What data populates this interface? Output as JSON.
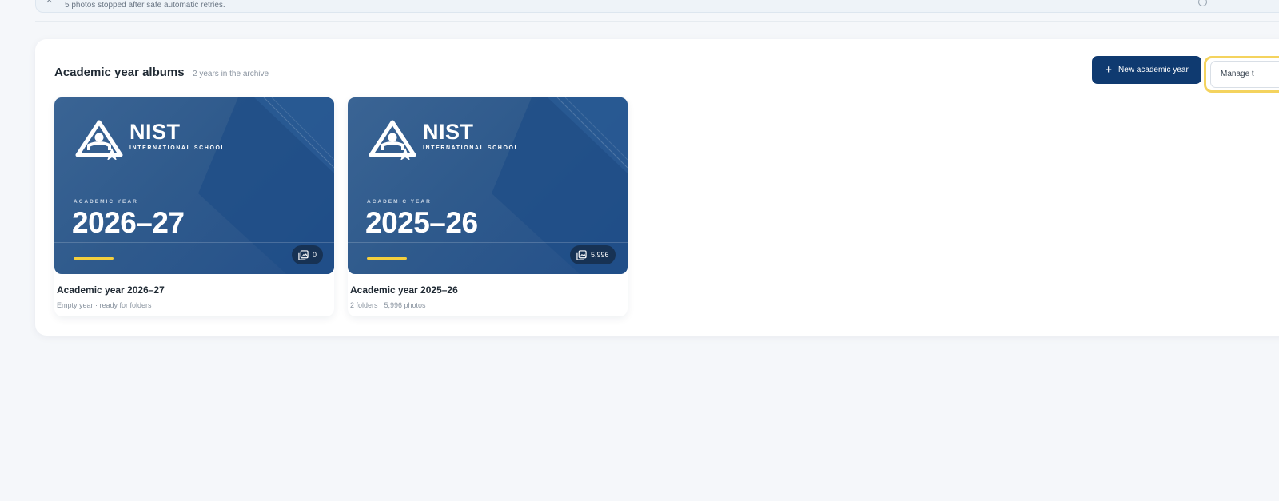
{
  "notice": {
    "text": "5 photos stopped after safe automatic retries."
  },
  "albums_section": {
    "title": "Academic year albums",
    "subtitle": "2 years in the archive",
    "new_year_button": "New academic year",
    "manage_button": "Manage t"
  },
  "albums": [
    {
      "brand_name": "NIST",
      "brand_sub": "INTERNATIONAL SCHOOL",
      "cover_label": "ACADEMIC YEAR",
      "cover_year": "2026–27",
      "photo_count": "0",
      "title": "Academic year 2026–27",
      "meta": "Empty year · ready for folders"
    },
    {
      "brand_name": "NIST",
      "brand_sub": "INTERNATIONAL SCHOOL",
      "cover_label": "ACADEMIC YEAR",
      "cover_year": "2025–26",
      "photo_count": "5,996",
      "title": "Academic year 2025–26",
      "meta": "2 folders · 5,996 photos"
    }
  ],
  "colors": {
    "primary": "#0f3a70",
    "accent": "#f4cf3d",
    "cover": "#2f5a8c"
  }
}
